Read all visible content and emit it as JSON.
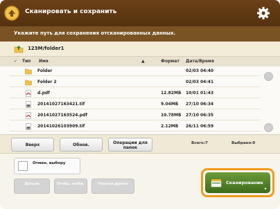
{
  "header": {
    "title": "Сканировать и сохранить",
    "settings_icon": "gear-icon",
    "app_icon": "scan-and-store-icon"
  },
  "instruction": "Укажите путь для сохранения отсканированных данных.",
  "path": {
    "label": "123M/folder1",
    "icon": "folder-up-icon"
  },
  "columns": {
    "type": "Тип",
    "name": "Имя",
    "format": "Формат",
    "datetime": "Дата/Время"
  },
  "files": [
    {
      "icon": "folder-icon",
      "name": "Folder",
      "size": "",
      "date": "02/03 04:40"
    },
    {
      "icon": "folder-icon",
      "name": "Folder 2",
      "size": "",
      "date": "02/03 04:41"
    },
    {
      "icon": "pdf-file-icon",
      "name": "d.pdf",
      "size": "12.82МБ",
      "date": "10/01 01:43"
    },
    {
      "icon": "image-file-icon",
      "name": "20141027163421.tif",
      "size": "9.04МБ",
      "date": "27/10 06:34"
    },
    {
      "icon": "pdf-file-icon",
      "name": "20141027163524.pdf",
      "size": "10.78МБ",
      "date": "27/10 06:35"
    },
    {
      "icon": "image-file-icon",
      "name": "20141026103909.tif",
      "size": "2.12МБ",
      "date": "26/11 06:59"
    }
  ],
  "toolbar": {
    "up": "Вверх",
    "refresh": "Обнов.",
    "operations": "Операции для папок",
    "total_label": "Всего:7",
    "selected_label": "Выбрано:0"
  },
  "lower": {
    "check_label": "Отмен. выбору",
    "btn_details": "Детали",
    "btn_display": "Отобр. изобр.",
    "btn_rename": "Переим.файла"
  },
  "scan": {
    "label": "Сканирование",
    "icon": "scan-icon"
  },
  "colors": {
    "header_brown": "#5e3813",
    "bar_brown": "#7a5324",
    "scan_green": "#4f7f28",
    "focus_orange": "#f09a1a"
  }
}
